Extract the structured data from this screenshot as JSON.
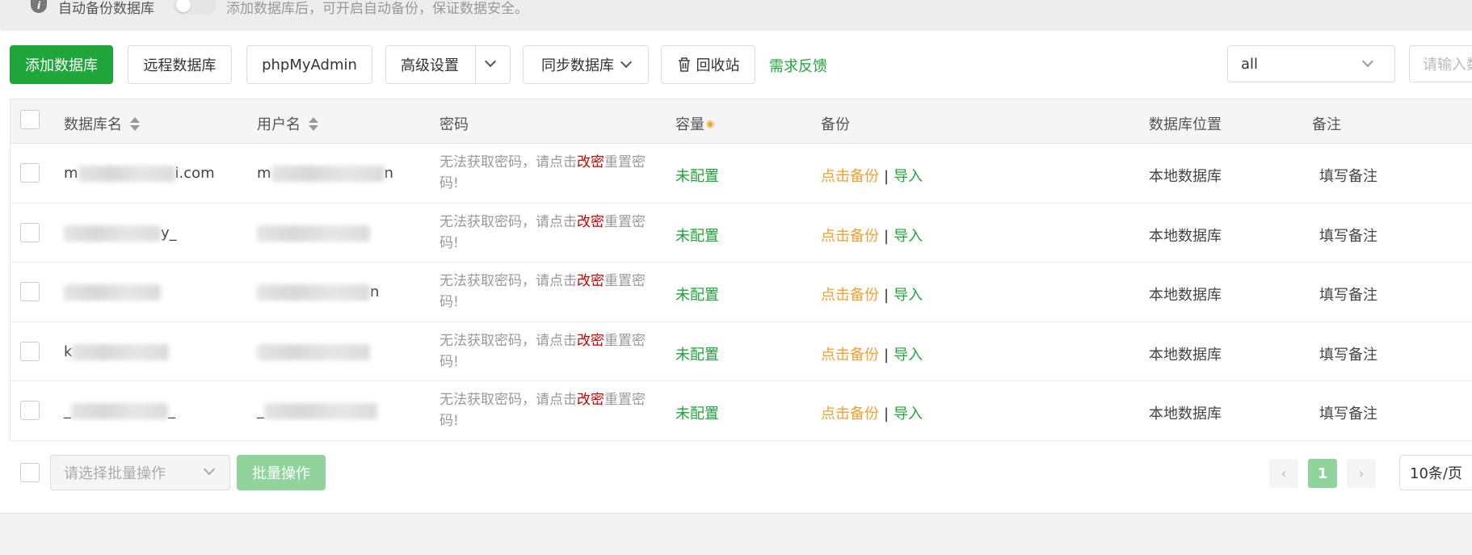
{
  "notice": {
    "label": "自动备份数据库",
    "tip": "添加数据库后，可开启自动备份，保证数据安全。"
  },
  "toolbar": {
    "add_db": "添加数据库",
    "remote_db": "远程数据库",
    "phpmyadmin": "phpMyAdmin",
    "advanced": "高级设置",
    "sync_db": "同步数据库",
    "recycle": "回收站",
    "feedback": "需求反馈",
    "filter_value": "all",
    "search_placeholder": "请输入数"
  },
  "table": {
    "headers": {
      "name": "数据库名",
      "user": "用户名",
      "password": "密码",
      "capacity": "容量",
      "backup": "备份",
      "location": "数据库位置",
      "remark": "备注"
    },
    "rows": [
      {
        "name_visible": "m",
        "name_suffix": "i.com",
        "user_visible": "m",
        "user_suffix": "n",
        "pw_a": "无法获取密码，请点击",
        "pw_link": "改密",
        "pw_b": "重置密码!",
        "capacity": "未配置",
        "backup": "点击备份",
        "import": "导入",
        "location": "本地数据库",
        "remark": "填写备注"
      },
      {
        "name_visible": "",
        "name_suffix": "y_",
        "user_visible": "",
        "user_suffix": "",
        "pw_a": "无法获取密码，请点击",
        "pw_link": "改密",
        "pw_b": "重置密码!",
        "capacity": "未配置",
        "backup": "点击备份",
        "import": "导入",
        "location": "本地数据库",
        "remark": "填写备注"
      },
      {
        "name_visible": "",
        "name_suffix": "",
        "user_visible": "",
        "user_suffix": "n",
        "pw_a": "无法获取密码，请点击",
        "pw_link": "改密",
        "pw_b": "重置密码!",
        "capacity": "未配置",
        "backup": "点击备份",
        "import": "导入",
        "location": "本地数据库",
        "remark": "填写备注"
      },
      {
        "name_visible": "k",
        "name_suffix": "",
        "user_visible": "",
        "user_suffix": "",
        "pw_a": "无法获取密码，请点击",
        "pw_link": "改密",
        "pw_b": "重置密码!",
        "capacity": "未配置",
        "backup": "点击备份",
        "import": "导入",
        "location": "本地数据库",
        "remark": "填写备注"
      },
      {
        "name_visible": "_",
        "name_suffix": "_",
        "user_visible": "_",
        "user_suffix": "",
        "pw_a": "无法获取密码，请点击",
        "pw_link": "改密",
        "pw_b": "重置密码!",
        "capacity": "未配置",
        "backup": "点击备份",
        "import": "导入",
        "location": "本地数据库",
        "remark": "填写备注"
      }
    ]
  },
  "footer": {
    "batch_placeholder": "请选择批量操作",
    "batch_button": "批量操作",
    "current_page": "1",
    "per_page": "10条/页"
  }
}
